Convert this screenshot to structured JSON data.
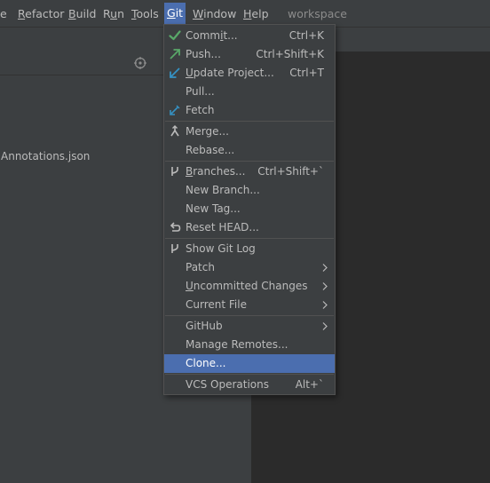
{
  "menubar": {
    "items": [
      {
        "label": "e"
      },
      {
        "label": "Refactor",
        "mn": "R",
        "rest": "efactor"
      },
      {
        "label": "Build",
        "mn": "B",
        "rest": "uild"
      },
      {
        "label": "Run",
        "mn": "u",
        "pre": "R",
        "rest": "n"
      },
      {
        "label": "Tools",
        "mn": "T",
        "rest": "ools"
      },
      {
        "label": "Git",
        "mn": "G",
        "rest": "it"
      },
      {
        "label": "Window",
        "mn": "W",
        "rest": "indow"
      },
      {
        "label": "Help",
        "mn": "H",
        "rest": "elp"
      }
    ],
    "project_name": "workspace"
  },
  "project_panel": {
    "file_name": "Annotations.json"
  },
  "git_menu": {
    "items": [
      {
        "label_pre": "Comm",
        "label_mn": "i",
        "label_post": "t...",
        "shortcut": "Ctrl+K",
        "icon": "check-icon"
      },
      {
        "label": "Push...",
        "shortcut": "Ctrl+Shift+K",
        "icon": "push-arrow-icon"
      },
      {
        "label_pre": "",
        "label_mn": "U",
        "label_post": "pdate Project...",
        "shortcut": "Ctrl+T",
        "icon": "update-arrow-icon"
      },
      {
        "label": "Pull..."
      },
      {
        "label": "Fetch",
        "icon": "fetch-icon"
      },
      {
        "label": "Merge...",
        "icon": "merge-icon"
      },
      {
        "label": "Rebase..."
      },
      {
        "label_pre": "",
        "label_mn": "B",
        "label_post": "ranches...",
        "shortcut": "Ctrl+Shift+`",
        "icon": "branch-icon"
      },
      {
        "label": "New Branch..."
      },
      {
        "label": "New Tag..."
      },
      {
        "label": "Reset HEAD...",
        "icon": "undo-icon"
      },
      {
        "label": "Show Git Log",
        "icon": "git-log-icon"
      },
      {
        "label": "Patch",
        "submenu": true
      },
      {
        "label_pre": "",
        "label_mn": "U",
        "label_post": "ncommitted Changes",
        "submenu": true
      },
      {
        "label": "Current File",
        "submenu": true
      },
      {
        "label": "GitHub",
        "submenu": true
      },
      {
        "label": "Manage Remotes..."
      },
      {
        "label": "Clone...",
        "highlighted": true
      },
      {
        "label": "VCS Operations",
        "shortcut": "Alt+`"
      }
    ]
  },
  "colors": {
    "background": "#3c3f41",
    "editor": "#2b2b2b",
    "highlight": "#4b6eaf",
    "check_green": "#59a869",
    "icon_blue": "#3592c4"
  }
}
